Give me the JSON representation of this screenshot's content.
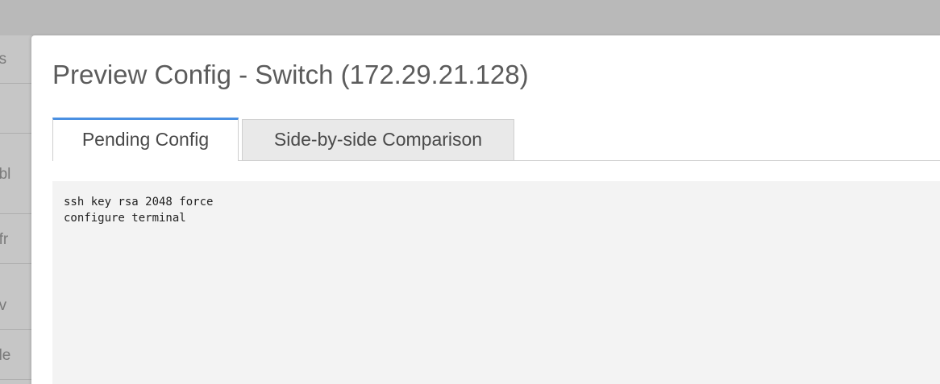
{
  "background_sidebar": {
    "items": [
      {
        "label": "ns"
      },
      {
        "label": ""
      },
      {
        "label": "abl"
      },
      {
        "label": "efr"
      },
      {
        "label": "av"
      },
      {
        "label": "ele"
      }
    ]
  },
  "modal": {
    "title": "Preview Config - Switch (172.29.21.128)",
    "tabs": [
      {
        "label": "Pending Config",
        "active": true
      },
      {
        "label": "Side-by-side Comparison",
        "active": false
      }
    ],
    "config_lines": [
      "ssh key rsa 2048 force",
      "configure terminal"
    ]
  },
  "colors": {
    "overlay": "#b9b9b9",
    "active_tab_accent": "#4a90e2",
    "title_text": "#5c5c5c",
    "config_background": "#f3f3f3"
  }
}
